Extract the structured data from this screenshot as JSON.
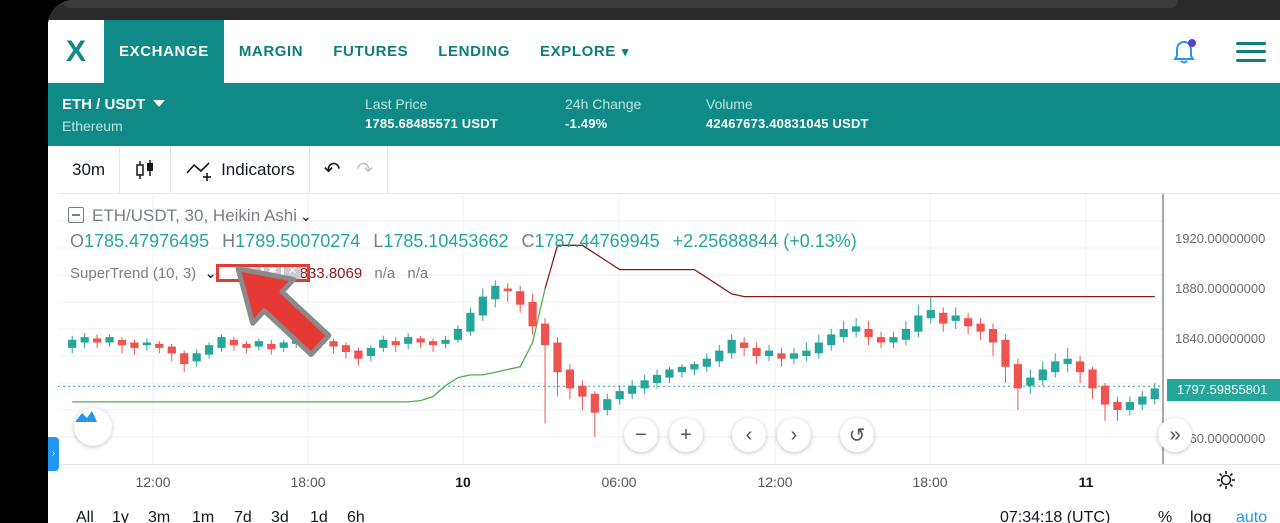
{
  "nav": {
    "logo": "X",
    "items": [
      "EXCHANGE",
      "MARGIN",
      "FUTURES",
      "LENDING",
      "EXPLORE"
    ],
    "explore_caret": "▾"
  },
  "ticker": {
    "pair": "ETH / USDT",
    "pair_name": "Ethereum",
    "last_price_label": "Last Price",
    "last_price": "1785.68485571 USDT",
    "change_label": "24h Change",
    "change": "-1.49%",
    "volume_label": "Volume",
    "volume": "42467673.40831045 USDT"
  },
  "toolbar": {
    "interval": "30m",
    "indicators": "Indicators",
    "undo": "↶",
    "redo": "↷"
  },
  "chart_info": {
    "title": "ETH/USDT, 30, Heikin Ashi",
    "o_key": "O",
    "o_val": "1785.47976495",
    "h_key": "H",
    "h_val": "1789.50070274",
    "l_key": "L",
    "l_val": "1785.10453662",
    "c_key": "C",
    "c_val": "1787.44769945",
    "chg": "+2.25688844 (+0.13%)",
    "supertrend_label": "SuperTrend (10, 3)",
    "supertrend_value": "1833.8069",
    "na1": "n/a",
    "na2": "n/a",
    "current_price": "1797.59855801"
  },
  "price_axis": [
    "1920.00000000",
    "1880.00000000",
    "1840.00000000",
    "1760.00000000"
  ],
  "time_axis": [
    "12:00",
    "18:00",
    "10",
    "06:00",
    "12:00",
    "18:00",
    "11"
  ],
  "range_bar": {
    "ranges": [
      "All",
      "1y",
      "3m",
      "1m",
      "7d",
      "3d",
      "1d",
      "6h"
    ],
    "clock": "07:34:18 (UTC)",
    "pct": "%",
    "log": "log",
    "auto": "auto"
  },
  "colors": {
    "brand": "#0f8a86",
    "up": "#26a69a",
    "down": "#ef5350",
    "supertrend_down": "#8b1a1a",
    "supertrend_up": "#4caf50",
    "highlight": "#e53935"
  },
  "chart_data": {
    "type": "candlestick",
    "price_ylim": [
      1740,
      1940
    ],
    "candles": [
      [
        1826,
        1832,
        1822,
        1835
      ],
      [
        1830,
        1834,
        1826,
        1837
      ],
      [
        1833,
        1830,
        1826,
        1836
      ],
      [
        1830,
        1834,
        1827,
        1836
      ],
      [
        1832,
        1828,
        1822,
        1834
      ],
      [
        1830,
        1826,
        1821,
        1832
      ],
      [
        1828,
        1830,
        1824,
        1833
      ],
      [
        1829,
        1826,
        1822,
        1831
      ],
      [
        1827,
        1822,
        1816,
        1829
      ],
      [
        1822,
        1814,
        1808,
        1824
      ],
      [
        1816,
        1822,
        1812,
        1825
      ],
      [
        1821,
        1828,
        1818,
        1830
      ],
      [
        1826,
        1834,
        1823,
        1836
      ],
      [
        1832,
        1828,
        1824,
        1834
      ],
      [
        1829,
        1826,
        1822,
        1831
      ],
      [
        1827,
        1831,
        1824,
        1833
      ],
      [
        1829,
        1825,
        1821,
        1832
      ],
      [
        1826,
        1830,
        1823,
        1832
      ],
      [
        1829,
        1833,
        1826,
        1839
      ],
      [
        1831,
        1828,
        1824,
        1834
      ],
      [
        1829,
        1832,
        1826,
        1836
      ],
      [
        1831,
        1827,
        1822,
        1833
      ],
      [
        1828,
        1823,
        1818,
        1830
      ],
      [
        1824,
        1818,
        1813,
        1826
      ],
      [
        1820,
        1826,
        1816,
        1828
      ],
      [
        1826,
        1832,
        1823,
        1835
      ],
      [
        1831,
        1828,
        1823,
        1834
      ],
      [
        1829,
        1834,
        1825,
        1837
      ],
      [
        1833,
        1830,
        1826,
        1835
      ],
      [
        1831,
        1828,
        1823,
        1833
      ],
      [
        1829,
        1832,
        1826,
        1835
      ],
      [
        1832,
        1840,
        1830,
        1843
      ],
      [
        1838,
        1852,
        1835,
        1856
      ],
      [
        1850,
        1864,
        1846,
        1870
      ],
      [
        1862,
        1872,
        1856,
        1876
      ],
      [
        1870,
        1868,
        1860,
        1874
      ],
      [
        1868,
        1858,
        1852,
        1872
      ],
      [
        1860,
        1842,
        1836,
        1866
      ],
      [
        1844,
        1828,
        1770,
        1848
      ],
      [
        1830,
        1808,
        1790,
        1834
      ],
      [
        1810,
        1796,
        1788,
        1814
      ],
      [
        1798,
        1790,
        1780,
        1802
      ],
      [
        1792,
        1778,
        1760,
        1794
      ],
      [
        1780,
        1788,
        1776,
        1792
      ],
      [
        1788,
        1794,
        1784,
        1798
      ],
      [
        1792,
        1798,
        1788,
        1802
      ],
      [
        1796,
        1802,
        1792,
        1806
      ],
      [
        1800,
        1806,
        1796,
        1810
      ],
      [
        1804,
        1810,
        1800,
        1812
      ],
      [
        1808,
        1812,
        1804,
        1814
      ],
      [
        1810,
        1814,
        1806,
        1816
      ],
      [
        1812,
        1818,
        1808,
        1822
      ],
      [
        1816,
        1824,
        1812,
        1828
      ],
      [
        1822,
        1832,
        1818,
        1836
      ],
      [
        1830,
        1826,
        1820,
        1834
      ],
      [
        1826,
        1820,
        1814,
        1830
      ],
      [
        1820,
        1824,
        1816,
        1828
      ],
      [
        1822,
        1818,
        1812,
        1826
      ],
      [
        1818,
        1822,
        1814,
        1826
      ],
      [
        1820,
        1824,
        1816,
        1830
      ],
      [
        1822,
        1830,
        1818,
        1836
      ],
      [
        1828,
        1836,
        1824,
        1840
      ],
      [
        1834,
        1840,
        1830,
        1846
      ],
      [
        1838,
        1842,
        1834,
        1848
      ],
      [
        1840,
        1834,
        1828,
        1846
      ],
      [
        1834,
        1830,
        1826,
        1838
      ],
      [
        1830,
        1834,
        1826,
        1838
      ],
      [
        1832,
        1840,
        1828,
        1846
      ],
      [
        1838,
        1850,
        1834,
        1858
      ],
      [
        1848,
        1854,
        1844,
        1864
      ],
      [
        1852,
        1844,
        1838,
        1856
      ],
      [
        1846,
        1850,
        1840,
        1856
      ],
      [
        1848,
        1842,
        1836,
        1852
      ],
      [
        1844,
        1838,
        1832,
        1848
      ],
      [
        1840,
        1830,
        1820,
        1844
      ],
      [
        1832,
        1812,
        1800,
        1836
      ],
      [
        1814,
        1796,
        1780,
        1818
      ],
      [
        1798,
        1804,
        1792,
        1810
      ],
      [
        1802,
        1810,
        1798,
        1816
      ],
      [
        1808,
        1816,
        1804,
        1822
      ],
      [
        1814,
        1818,
        1808,
        1826
      ],
      [
        1816,
        1808,
        1800,
        1820
      ],
      [
        1810,
        1796,
        1788,
        1812
      ],
      [
        1798,
        1784,
        1772,
        1800
      ],
      [
        1786,
        1780,
        1772,
        1790
      ],
      [
        1780,
        1786,
        1776,
        1790
      ],
      [
        1784,
        1790,
        1780,
        1794
      ],
      [
        1788,
        1796,
        1784,
        1800
      ]
    ],
    "supertrend": [
      [
        0,
        1786
      ],
      [
        1,
        1786
      ],
      [
        2,
        1786
      ],
      [
        3,
        1786
      ],
      [
        4,
        1786
      ],
      [
        5,
        1786
      ],
      [
        6,
        1786
      ],
      [
        7,
        1786
      ],
      [
        8,
        1786
      ],
      [
        9,
        1786
      ],
      [
        10,
        1786
      ],
      [
        11,
        1786
      ],
      [
        12,
        1786
      ],
      [
        13,
        1786
      ],
      [
        14,
        1786
      ],
      [
        15,
        1786
      ],
      [
        16,
        1786
      ],
      [
        17,
        1786
      ],
      [
        18,
        1786
      ],
      [
        19,
        1786
      ],
      [
        20,
        1786
      ],
      [
        21,
        1786
      ],
      [
        22,
        1786
      ],
      [
        23,
        1786
      ],
      [
        24,
        1786
      ],
      [
        25,
        1786
      ],
      [
        26,
        1786
      ],
      [
        27,
        1786
      ],
      [
        28,
        1787
      ],
      [
        29,
        1790
      ],
      [
        30,
        1798
      ],
      [
        31,
        1804
      ],
      [
        32,
        1806
      ],
      [
        33,
        1806
      ],
      [
        34,
        1808
      ],
      [
        35,
        1810
      ],
      [
        36,
        1812
      ],
      [
        37,
        1830
      ],
      [
        38,
        1870
      ],
      [
        39,
        1902
      ],
      [
        40,
        1902
      ],
      [
        41,
        1902
      ],
      [
        42,
        1896
      ],
      [
        43,
        1890
      ],
      [
        44,
        1884
      ],
      [
        45,
        1884
      ],
      [
        46,
        1884
      ],
      [
        47,
        1884
      ],
      [
        48,
        1884
      ],
      [
        49,
        1884
      ],
      [
        50,
        1884
      ],
      [
        51,
        1878
      ],
      [
        52,
        1872
      ],
      [
        53,
        1866
      ],
      [
        54,
        1864
      ],
      [
        55,
        1864
      ],
      [
        56,
        1864
      ],
      [
        57,
        1864
      ],
      [
        58,
        1864
      ],
      [
        59,
        1864
      ],
      [
        60,
        1864
      ],
      [
        61,
        1864
      ],
      [
        62,
        1864
      ],
      [
        63,
        1864
      ],
      [
        64,
        1864
      ],
      [
        65,
        1864
      ],
      [
        66,
        1864
      ],
      [
        67,
        1864
      ],
      [
        68,
        1864
      ],
      [
        69,
        1864
      ],
      [
        70,
        1864
      ],
      [
        71,
        1864
      ],
      [
        72,
        1864
      ],
      [
        73,
        1864
      ],
      [
        74,
        1864
      ],
      [
        75,
        1864
      ],
      [
        76,
        1864
      ],
      [
        77,
        1864
      ],
      [
        78,
        1864
      ],
      [
        79,
        1864
      ],
      [
        80,
        1864
      ],
      [
        81,
        1864
      ],
      [
        82,
        1864
      ],
      [
        83,
        1864
      ],
      [
        84,
        1864
      ],
      [
        85,
        1864
      ],
      [
        86,
        1864
      ],
      [
        87,
        1864
      ]
    ]
  }
}
